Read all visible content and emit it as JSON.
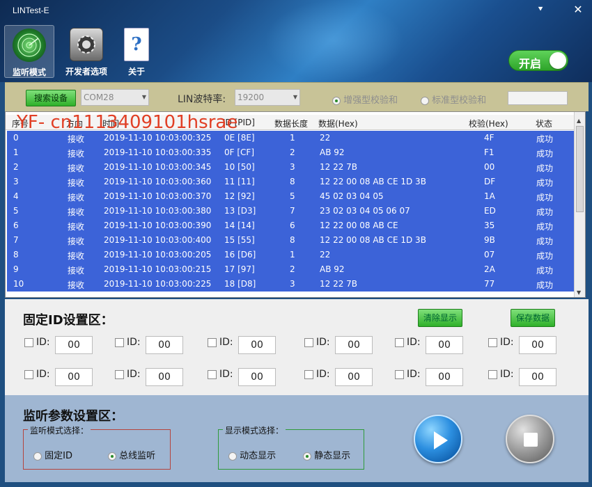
{
  "app": {
    "title": "LINTest-E"
  },
  "window": {
    "menu_glyph": "⯆",
    "close_glyph": "✕"
  },
  "toolbar": {
    "items": [
      {
        "label": "监听模式",
        "icon": "radar-icon",
        "active": true
      },
      {
        "label": "开发者选项",
        "icon": "gear-icon",
        "active": false
      },
      {
        "label": "关于",
        "icon": "help-document-icon",
        "active": false
      }
    ],
    "toggle_label": "开启",
    "toggle_on": true
  },
  "settings": {
    "search_label": "搜索设备",
    "port_value": "COM28",
    "baud_label": "LIN波特率:",
    "baud_value": "19200",
    "checksum_enhanced": "增强型校验和",
    "checksum_standard": "标准型校验和",
    "selected_checksum": "增强型校验和"
  },
  "table": {
    "columns": [
      "序号",
      "方向",
      "时间",
      "ID [PID]",
      "数据长度",
      "数据(Hex)",
      "校验(Hex)",
      "状态"
    ],
    "rows": [
      [
        "0",
        "接收",
        "2019-11-10 10:03:00:325",
        "0E [8E]",
        "1",
        "22",
        "4F",
        "成功"
      ],
      [
        "1",
        "接收",
        "2019-11-10 10:03:00:335",
        "0F [CF]",
        "2",
        "AB 92",
        "F1",
        "成功"
      ],
      [
        "2",
        "接收",
        "2019-11-10 10:03:00:345",
        "10 [50]",
        "3",
        "12 22 7B",
        "00",
        "成功"
      ],
      [
        "3",
        "接收",
        "2019-11-10 10:03:00:360",
        "11 [11]",
        "8",
        "12 22 00 08 AB CE 1D 3B",
        "DF",
        "成功"
      ],
      [
        "4",
        "接收",
        "2019-11-10 10:03:00:370",
        "12 [92]",
        "5",
        "45 02 03 04 05",
        "1A",
        "成功"
      ],
      [
        "5",
        "接收",
        "2019-11-10 10:03:00:380",
        "13 [D3]",
        "7",
        "23 02 03 04 05 06 07",
        "ED",
        "成功"
      ],
      [
        "6",
        "接收",
        "2019-11-10 10:03:00:390",
        "14 [14]",
        "6",
        "12 22 00 08 AB CE",
        "35",
        "成功"
      ],
      [
        "7",
        "接收",
        "2019-11-10 10:03:00:400",
        "15 [55]",
        "8",
        "12 22 00 08 AB CE 1D 3B",
        "9B",
        "成功"
      ],
      [
        "8",
        "接收",
        "2019-11-10 10:03:00:205",
        "16 [D6]",
        "1",
        "22",
        "07",
        "成功"
      ],
      [
        "9",
        "接收",
        "2019-11-10 10:03:00:215",
        "17 [97]",
        "2",
        "AB 92",
        "2A",
        "成功"
      ],
      [
        "10",
        "接收",
        "2019-11-10 10:03:00:225",
        "18 [D8]",
        "3",
        "12 22 7B",
        "77",
        "成功"
      ]
    ],
    "row_color": "#3c63d8"
  },
  "watermark": "YF- cn1113409101hsrae",
  "fixed_id": {
    "title": "固定ID设置区：",
    "clear_label": "清除显示",
    "save_label": "保存数据",
    "id_label": "ID:",
    "values": [
      "00",
      "00",
      "00",
      "00",
      "00",
      "00",
      "00",
      "00",
      "00",
      "00",
      "00",
      "00"
    ]
  },
  "monitor": {
    "title": "监听参数设置区：",
    "mode_group": "监听模式选择：",
    "mode_fixed": "固定ID",
    "mode_bus": "总线监听",
    "selected_mode": "总线监听",
    "display_group": "显示模式选择：",
    "display_dynamic": "动态显示",
    "display_static": "静态显示",
    "selected_display": "静态显示"
  },
  "colors": {
    "accent_green": "#2fb02a",
    "header_blue": "#1b4c86",
    "panel_blue": "#9fb6d2",
    "strip_khaki": "#c8c397"
  }
}
